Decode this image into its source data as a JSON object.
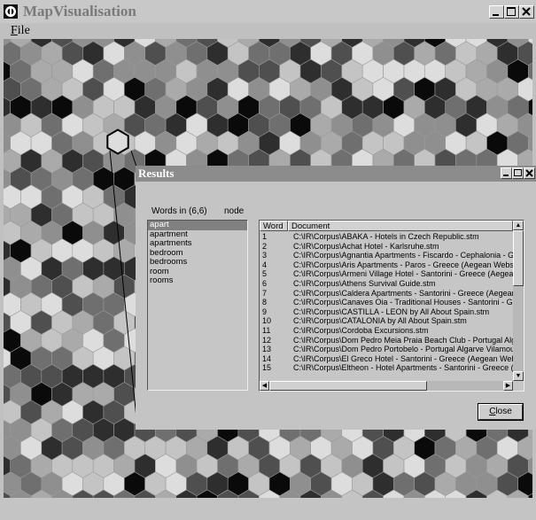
{
  "window": {
    "title": "MapVisualisation",
    "icon": "app-logo-icon",
    "controls": [
      "minimize-icon",
      "maximize-icon",
      "close-icon"
    ]
  },
  "menu": {
    "file_mnemonic": "F",
    "file_rest": "ile"
  },
  "map": {
    "description_colors": [
      "#0a0a0a",
      "#2e2e2e",
      "#4f4f4f",
      "#6f6f6f",
      "#8f8f8f",
      "#aaaaaa",
      "#c4c4c4",
      "#dddddd"
    ],
    "selected_cell_outline": "#000000"
  },
  "dialog": {
    "title": "Results",
    "words_label": "Words in (6,6)",
    "node_label": "node",
    "words": [
      "apart",
      "apartment",
      "apartments",
      "bedroom",
      "bedrooms",
      "room",
      "rooms"
    ],
    "selected_word": "apart",
    "columns": [
      "Word",
      "Document"
    ],
    "documents": [
      {
        "num": "1",
        "doc": "C:\\IR\\Corpus\\ABAKA - Hotels in Czech Republic.stm"
      },
      {
        "num": "2",
        "doc": "C:\\IR\\Corpus\\Achat Hotel - Karlsruhe.stm"
      },
      {
        "num": "3",
        "doc": "C:\\IR\\Corpus\\Agnantia Apartments - Fiscardo - Cephalonia - Gre"
      },
      {
        "num": "4",
        "doc": "C:\\IR\\Corpus\\Aris Apartments - Paros - Greece (Aegean Webser"
      },
      {
        "num": "5",
        "doc": "C:\\IR\\Corpus\\Armeni Village Hotel - Santorini - Greece (Aegean V"
      },
      {
        "num": "6",
        "doc": "C:\\IR\\Corpus\\Athens Survival Guide.stm"
      },
      {
        "num": "7",
        "doc": "C:\\IR\\Corpus\\Caldera Apartments - Santorini - Greece (Aegean \\"
      },
      {
        "num": "8",
        "doc": "C:\\IR\\Corpus\\Canaves Oia - Traditional Houses - Santorini - Gre"
      },
      {
        "num": "9",
        "doc": "C:\\IR\\Corpus\\CASTILLA - LEON by All About Spain.stm"
      },
      {
        "num": "10",
        "doc": "C:\\IR\\Corpus\\CATALONIA by All About Spain.stm"
      },
      {
        "num": "11",
        "doc": "C:\\IR\\Corpus\\Cordoba Excursions.stm"
      },
      {
        "num": "12",
        "doc": "C:\\IR\\Corpus\\Dom Pedro Meia Praia Beach Club - Portugal Alga"
      },
      {
        "num": "13",
        "doc": "C:\\IR\\Corpus\\Dom Pedro Portobelo - Portugal Algarve Vilamoura"
      },
      {
        "num": "14",
        "doc": "C:\\IR\\Corpus\\El Greco Hotel - Santorini - Greece (Aegean Webs"
      },
      {
        "num": "15",
        "doc": "C:\\IR\\Corpus\\Eltheon - Hotel Apartments - Santorini - Greece (A"
      }
    ],
    "close_mnemonic": "C",
    "close_rest": "lose"
  }
}
